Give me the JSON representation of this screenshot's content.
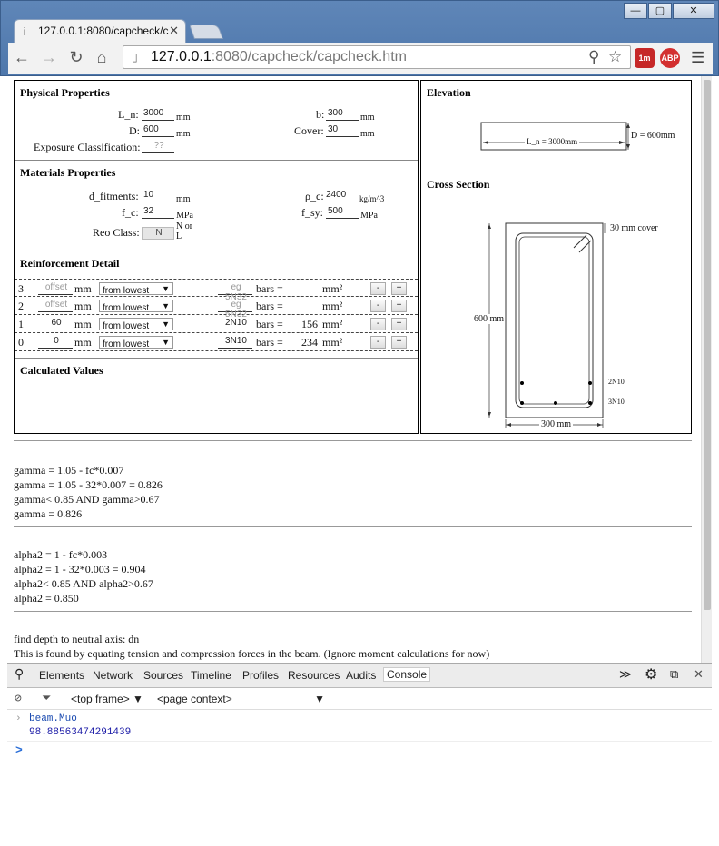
{
  "window": {
    "tab_title": "127.0.0.1:8080/capcheck/c",
    "controls": [
      "—",
      "▢",
      "✕"
    ]
  },
  "toolbar": {
    "url_host": "127.0.0.1",
    "url_rest": ":8080/capcheck/capcheck.htm",
    "ext_timer": "1m",
    "ext_abp": "ABP"
  },
  "physical": {
    "title": "Physical Properties",
    "ln_label": "L_n:",
    "ln_value": "3000",
    "ln_unit": "mm",
    "b_label": "b:",
    "b_value": "300",
    "b_unit": "mm",
    "d_label": "D:",
    "d_value": "600",
    "d_unit": "mm",
    "cover_label": "Cover:",
    "cover_value": "30",
    "cover_unit": "mm",
    "exposure_label": "Exposure Classification:",
    "exposure_placeholder": "??"
  },
  "materials": {
    "title": "Materials Properties",
    "dfit_label": "d_fitments:",
    "dfit_value": "10",
    "dfit_unit": "mm",
    "rho_label": "ρ_c:",
    "rho_value": "2400",
    "rho_unit": "kg/m^3",
    "fc_label": "f_c:",
    "fc_value": "32",
    "fc_unit": "MPa",
    "fsy_label": "f_sy:",
    "fsy_value": "500",
    "fsy_unit": "MPa",
    "reo_label": "Reo Class:",
    "reo_value": "N",
    "reo_hint": "N or L"
  },
  "reinforcement": {
    "title": "Reinforcement Detail",
    "rows": [
      {
        "idx": "3",
        "offset": "",
        "offset_ph": "offset",
        "unit": "mm",
        "mode": "from lowest",
        "bars": "",
        "bars_ph": "eg 5N32",
        "bars_eq": "bars =",
        "area": "",
        "area_unit": "mm²"
      },
      {
        "idx": "2",
        "offset": "",
        "offset_ph": "offset",
        "unit": "mm",
        "mode": "from lowest",
        "bars": "",
        "bars_ph": "eg 5N32",
        "bars_eq": "bars =",
        "area": "",
        "area_unit": "mm²"
      },
      {
        "idx": "1",
        "offset": "60",
        "offset_ph": "",
        "unit": "mm",
        "mode": "from lowest",
        "bars": "2N10",
        "bars_ph": "",
        "bars_eq": "bars =",
        "area": "156",
        "area_unit": "mm²"
      },
      {
        "idx": "0",
        "offset": "0",
        "offset_ph": "",
        "unit": "mm",
        "mode": "from lowest",
        "bars": "3N10",
        "bars_ph": "",
        "bars_eq": "bars =",
        "area": "234",
        "area_unit": "mm²"
      }
    ],
    "minus": "-",
    "plus": "+"
  },
  "calculated": {
    "title": "Calculated Values"
  },
  "elevation": {
    "title": "Elevation",
    "span_label": "L_n = 3000mm",
    "depth_label": "D = 600mm"
  },
  "cross_section": {
    "title": "Cross Section",
    "cover_label": "30 mm cover",
    "height_label": "600 mm",
    "width_label": "300 mm",
    "top_bars_label": "2N10",
    "bottom_bars_label": "3N10"
  },
  "calcs": {
    "gamma": [
      "gamma = 1.05 - fc*0.007",
      "gamma = 1.05 - 32*0.007 = 0.826",
      "gamma< 0.85 AND gamma>0.67",
      "gamma = 0.826"
    ],
    "alpha": [
      "alpha2 = 1 - fc*0.003",
      "alpha2 = 1 - 32*0.003 = 0.904",
      "alpha2< 0.85 AND alpha2>0.67",
      "alpha2 = 0.850"
    ],
    "neutral": [
      "find depth to neutral axis: dn",
      "This is found by equating tension and compression forces in the beam. (Ignore moment calculations for now)"
    ]
  },
  "devtools": {
    "tabs": [
      "Elements",
      "Network",
      "Sources",
      "Timeline",
      "Profiles",
      "Resources",
      "Audits",
      "Console"
    ],
    "frame": "<top frame>",
    "context": "<page context>",
    "command": "beam.Muo",
    "result": "98.88563474291439",
    "prompt": ">"
  }
}
